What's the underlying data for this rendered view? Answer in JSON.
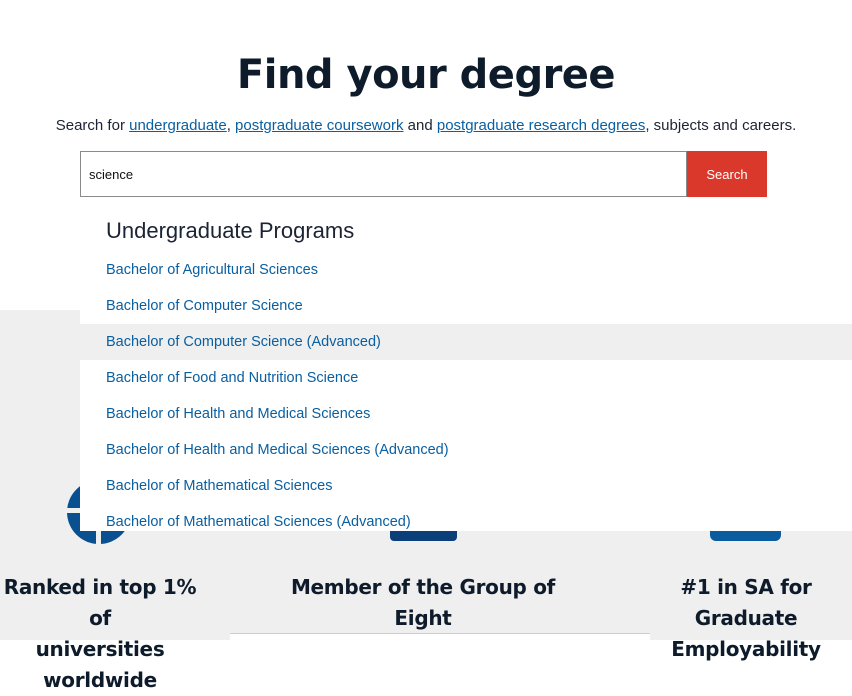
{
  "title": "Find your degree",
  "intro": {
    "prefix": "Search for ",
    "link1": "undergraduate",
    "sep1": ", ",
    "link2": "postgraduate coursework",
    "sep2": " and ",
    "link3": "postgraduate research degrees",
    "suffix": ", subjects and careers."
  },
  "search": {
    "value": "science",
    "button_label": "Search"
  },
  "dropdown": {
    "heading": "Undergraduate Programs",
    "items": [
      "Bachelor of Agricultural Sciences",
      "Bachelor of Computer Science",
      "Bachelor of Computer Science (Advanced)",
      "Bachelor of Food and Nutrition Science",
      "Bachelor of Health and Medical Sciences",
      "Bachelor of Health and Medical Sciences (Advanced)",
      "Bachelor of Mathematical Sciences",
      "Bachelor of Mathematical Sciences (Advanced)"
    ]
  },
  "stats": {
    "s1_line1": "Ranked in top 1% of",
    "s1_line2": "universities worldwide",
    "s2": "Member of the Group of Eight",
    "s3_line1": "#1 in SA for Graduate",
    "s3_line2": "Employability"
  },
  "icons": {
    "globe": "globe-icon",
    "badge2": "group-of-eight-icon",
    "badge3": "employability-icon"
  },
  "colors": {
    "accent_red": "#d9382a",
    "link_blue": "#0a5fa0",
    "navy": "#0e1b2b",
    "band_grey": "#efefef"
  }
}
